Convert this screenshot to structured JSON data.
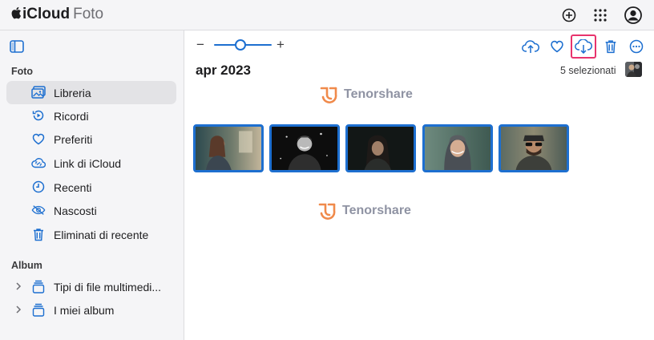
{
  "app": {
    "brand_prefix": "iCloud",
    "brand_name": "Foto"
  },
  "topbar": {
    "icons": [
      "add-circle-icon",
      "app-grid-icon",
      "account-icon"
    ]
  },
  "sidebar": {
    "toggle_icon": "sidebar-toggle-icon",
    "sections": [
      {
        "title": "Foto",
        "items": [
          {
            "label": "Libreria",
            "icon": "photo-library-icon",
            "active": true
          },
          {
            "label": "Ricordi",
            "icon": "memories-icon",
            "active": false
          },
          {
            "label": "Preferiti",
            "icon": "heart-icon",
            "active": false
          },
          {
            "label": "Link di iCloud",
            "icon": "cloud-link-icon",
            "active": false
          },
          {
            "label": "Recenti",
            "icon": "clock-icon",
            "active": false
          },
          {
            "label": "Nascosti",
            "icon": "eye-slash-icon",
            "active": false
          },
          {
            "label": "Eliminati di recente",
            "icon": "trash-icon",
            "active": false
          }
        ]
      },
      {
        "title": "Album",
        "items": [
          {
            "label": "Tipi di file multimedi...",
            "icon": "stack-icon",
            "expandable": true
          },
          {
            "label": "I miei album",
            "icon": "stack-icon",
            "expandable": true
          }
        ]
      }
    ]
  },
  "toolbar": {
    "zoom_minus": "−",
    "zoom_plus": "+",
    "zoom_level": 0.45,
    "actions": [
      {
        "name": "upload",
        "icon": "cloud-upload-icon"
      },
      {
        "name": "favorite",
        "icon": "heart-icon"
      },
      {
        "name": "download",
        "icon": "cloud-download-icon",
        "highlighted": true
      },
      {
        "name": "delete",
        "icon": "trash-icon"
      },
      {
        "name": "more",
        "icon": "ellipsis-circle-icon"
      }
    ]
  },
  "content": {
    "date_heading": "apr 2023",
    "selection_text": "5 selezionati",
    "watermark": "Tenorshare",
    "photos": [
      {
        "subject": "woman-in-window-light",
        "selected": true
      },
      {
        "subject": "smiling-man-black-and-white",
        "selected": true
      },
      {
        "subject": "woman-in-dark",
        "selected": true
      },
      {
        "subject": "woman-with-headscarf",
        "selected": true
      },
      {
        "subject": "man-with-sunglasses",
        "selected": true
      }
    ]
  },
  "colors": {
    "accent": "#1d6fd0",
    "highlight": "#e8336d",
    "sidebar_bg": "#f5f5f7",
    "watermark_orange": "#f08a4b"
  }
}
